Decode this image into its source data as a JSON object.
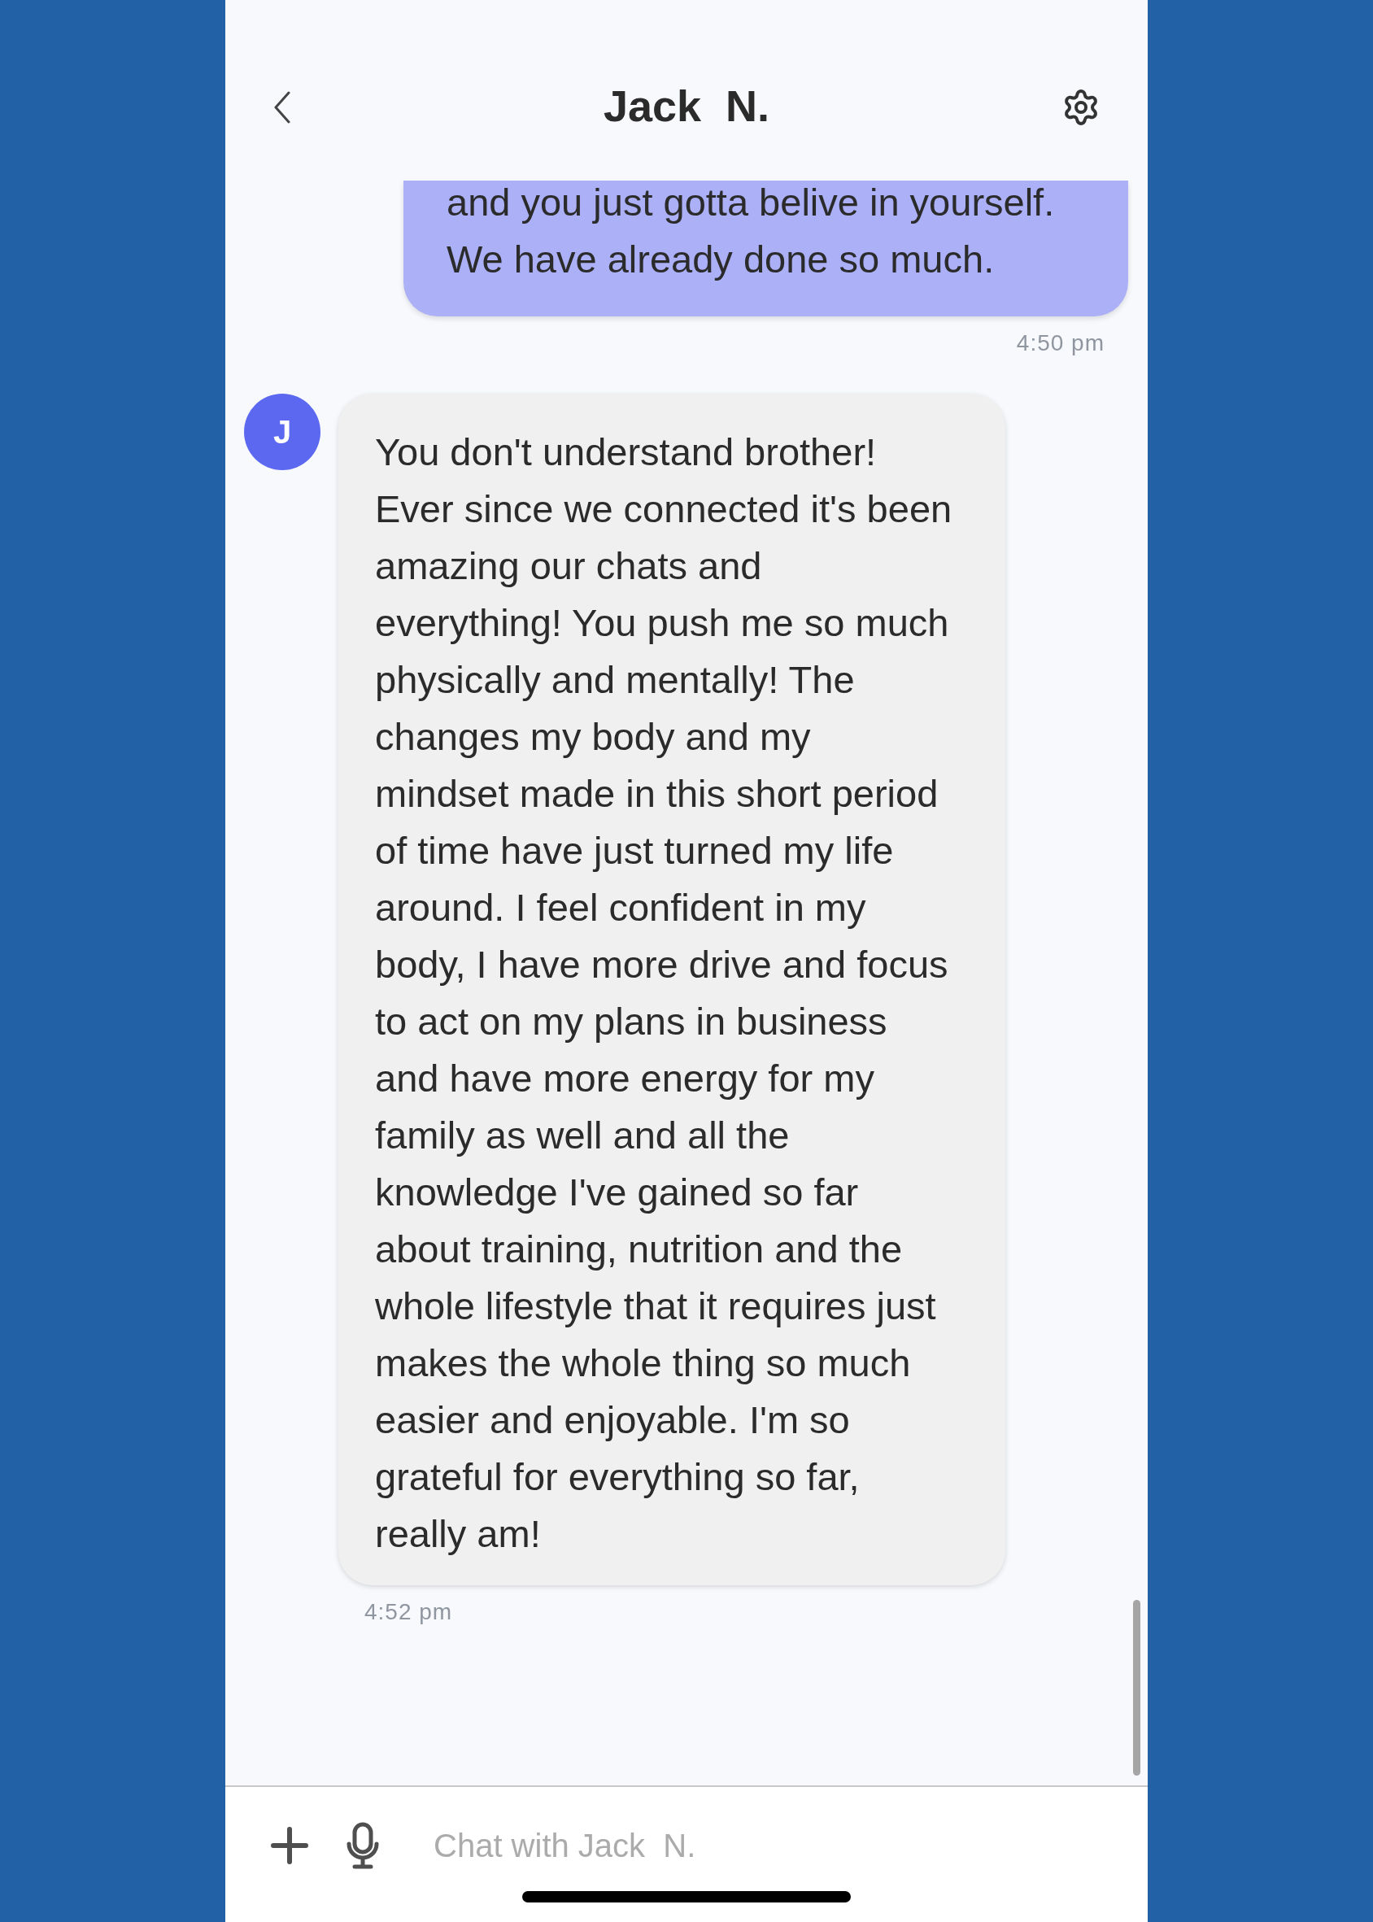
{
  "header": {
    "title": "Jack  N."
  },
  "messages": [
    {
      "kind": "sent",
      "text": "and you just gotta belive in yourself.\nWe have already done so much.",
      "time": "4:50 pm"
    },
    {
      "kind": "received",
      "avatar": "J",
      "text": "You don't understand brother!\nEver since we connected it's been\namazing our chats and\neverything! You push me so much\nphysically and mentally! The\nchanges my body and my\nmindset made in this short period\nof time have just turned my life\naround. I feel confident in my\nbody, I have more drive and focus\nto act on my plans in business\nand have more energy for my\nfamily as well and all the\nknowledge I've gained so far\nabout training, nutrition and the\nwhole lifestyle that it requires just\nmakes the whole thing so much\neasier and enjoyable. I'm so\ngrateful for everything so far,\nreally am!",
      "time": "4:52 pm"
    }
  ],
  "composer": {
    "placeholder": "Chat with Jack  N."
  }
}
